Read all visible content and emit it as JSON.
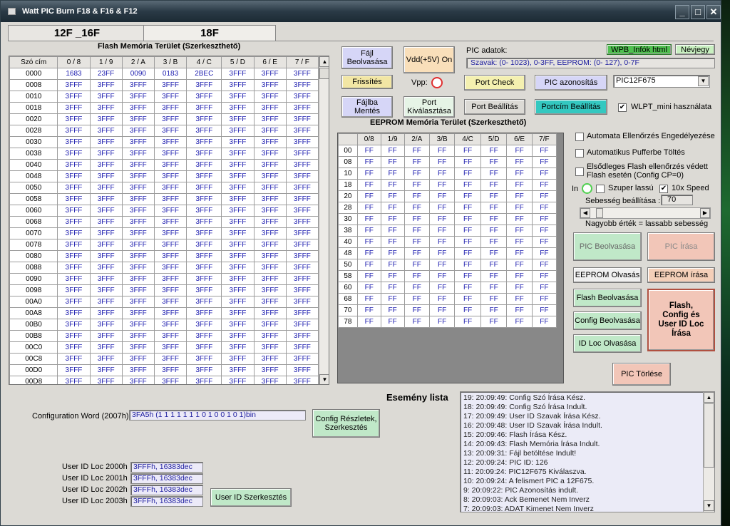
{
  "window": {
    "title": "Watt PIC Burn F18 & F16 & F12"
  },
  "tabs": [
    "12F _16F",
    "18F"
  ],
  "flash": {
    "title": "Flash Memória Terület (Szerkeszthető)",
    "headers": [
      "Szó cím",
      "0 / 8",
      "1 / 9",
      "2 / A",
      "3 / B",
      "4 / C",
      "5 / D",
      "6 / E",
      "7 / F"
    ],
    "rows": [
      [
        "0000",
        "1683",
        "23FF",
        "0090",
        "0183",
        "2BEC",
        "3FFF",
        "3FFF",
        "3FFF"
      ],
      [
        "0008",
        "3FFF",
        "3FFF",
        "3FFF",
        "3FFF",
        "3FFF",
        "3FFF",
        "3FFF",
        "3FFF"
      ],
      [
        "0010",
        "3FFF",
        "3FFF",
        "3FFF",
        "3FFF",
        "3FFF",
        "3FFF",
        "3FFF",
        "3FFF"
      ],
      [
        "0018",
        "3FFF",
        "3FFF",
        "3FFF",
        "3FFF",
        "3FFF",
        "3FFF",
        "3FFF",
        "3FFF"
      ],
      [
        "0020",
        "3FFF",
        "3FFF",
        "3FFF",
        "3FFF",
        "3FFF",
        "3FFF",
        "3FFF",
        "3FFF"
      ],
      [
        "0028",
        "3FFF",
        "3FFF",
        "3FFF",
        "3FFF",
        "3FFF",
        "3FFF",
        "3FFF",
        "3FFF"
      ],
      [
        "0030",
        "3FFF",
        "3FFF",
        "3FFF",
        "3FFF",
        "3FFF",
        "3FFF",
        "3FFF",
        "3FFF"
      ],
      [
        "0038",
        "3FFF",
        "3FFF",
        "3FFF",
        "3FFF",
        "3FFF",
        "3FFF",
        "3FFF",
        "3FFF"
      ],
      [
        "0040",
        "3FFF",
        "3FFF",
        "3FFF",
        "3FFF",
        "3FFF",
        "3FFF",
        "3FFF",
        "3FFF"
      ],
      [
        "0048",
        "3FFF",
        "3FFF",
        "3FFF",
        "3FFF",
        "3FFF",
        "3FFF",
        "3FFF",
        "3FFF"
      ],
      [
        "0050",
        "3FFF",
        "3FFF",
        "3FFF",
        "3FFF",
        "3FFF",
        "3FFF",
        "3FFF",
        "3FFF"
      ],
      [
        "0058",
        "3FFF",
        "3FFF",
        "3FFF",
        "3FFF",
        "3FFF",
        "3FFF",
        "3FFF",
        "3FFF"
      ],
      [
        "0060",
        "3FFF",
        "3FFF",
        "3FFF",
        "3FFF",
        "3FFF",
        "3FFF",
        "3FFF",
        "3FFF"
      ],
      [
        "0068",
        "3FFF",
        "3FFF",
        "3FFF",
        "3FFF",
        "3FFF",
        "3FFF",
        "3FFF",
        "3FFF"
      ],
      [
        "0070",
        "3FFF",
        "3FFF",
        "3FFF",
        "3FFF",
        "3FFF",
        "3FFF",
        "3FFF",
        "3FFF"
      ],
      [
        "0078",
        "3FFF",
        "3FFF",
        "3FFF",
        "3FFF",
        "3FFF",
        "3FFF",
        "3FFF",
        "3FFF"
      ],
      [
        "0080",
        "3FFF",
        "3FFF",
        "3FFF",
        "3FFF",
        "3FFF",
        "3FFF",
        "3FFF",
        "3FFF"
      ],
      [
        "0088",
        "3FFF",
        "3FFF",
        "3FFF",
        "3FFF",
        "3FFF",
        "3FFF",
        "3FFF",
        "3FFF"
      ],
      [
        "0090",
        "3FFF",
        "3FFF",
        "3FFF",
        "3FFF",
        "3FFF",
        "3FFF",
        "3FFF",
        "3FFF"
      ],
      [
        "0098",
        "3FFF",
        "3FFF",
        "3FFF",
        "3FFF",
        "3FFF",
        "3FFF",
        "3FFF",
        "3FFF"
      ],
      [
        "00A0",
        "3FFF",
        "3FFF",
        "3FFF",
        "3FFF",
        "3FFF",
        "3FFF",
        "3FFF",
        "3FFF"
      ],
      [
        "00A8",
        "3FFF",
        "3FFF",
        "3FFF",
        "3FFF",
        "3FFF",
        "3FFF",
        "3FFF",
        "3FFF"
      ],
      [
        "00B0",
        "3FFF",
        "3FFF",
        "3FFF",
        "3FFF",
        "3FFF",
        "3FFF",
        "3FFF",
        "3FFF"
      ],
      [
        "00B8",
        "3FFF",
        "3FFF",
        "3FFF",
        "3FFF",
        "3FFF",
        "3FFF",
        "3FFF",
        "3FFF"
      ],
      [
        "00C0",
        "3FFF",
        "3FFF",
        "3FFF",
        "3FFF",
        "3FFF",
        "3FFF",
        "3FFF",
        "3FFF"
      ],
      [
        "00C8",
        "3FFF",
        "3FFF",
        "3FFF",
        "3FFF",
        "3FFF",
        "3FFF",
        "3FFF",
        "3FFF"
      ],
      [
        "00D0",
        "3FFF",
        "3FFF",
        "3FFF",
        "3FFF",
        "3FFF",
        "3FFF",
        "3FFF",
        "3FFF"
      ],
      [
        "00D8",
        "3FFF",
        "3FFF",
        "3FFF",
        "3FFF",
        "3FFF",
        "3FFF",
        "3FFF",
        "3FFF"
      ]
    ]
  },
  "eeprom": {
    "title": "EEPROM Memória Terület (Szerkeszthető)",
    "headers": [
      "",
      "0/8",
      "1/9",
      "2/A",
      "3/B",
      "4/C",
      "5/D",
      "6/E",
      "7/F"
    ],
    "rows": [
      [
        "00",
        "FF",
        "FF",
        "FF",
        "FF",
        "FF",
        "FF",
        "FF",
        "FF"
      ],
      [
        "08",
        "FF",
        "FF",
        "FF",
        "FF",
        "FF",
        "FF",
        "FF",
        "FF"
      ],
      [
        "10",
        "FF",
        "FF",
        "FF",
        "FF",
        "FF",
        "FF",
        "FF",
        "FF"
      ],
      [
        "18",
        "FF",
        "FF",
        "FF",
        "FF",
        "FF",
        "FF",
        "FF",
        "FF"
      ],
      [
        "20",
        "FF",
        "FF",
        "FF",
        "FF",
        "FF",
        "FF",
        "FF",
        "FF"
      ],
      [
        "28",
        "FF",
        "FF",
        "FF",
        "FF",
        "FF",
        "FF",
        "FF",
        "FF"
      ],
      [
        "30",
        "FF",
        "FF",
        "FF",
        "FF",
        "FF",
        "FF",
        "FF",
        "FF"
      ],
      [
        "38",
        "FF",
        "FF",
        "FF",
        "FF",
        "FF",
        "FF",
        "FF",
        "FF"
      ],
      [
        "40",
        "FF",
        "FF",
        "FF",
        "FF",
        "FF",
        "FF",
        "FF",
        "FF"
      ],
      [
        "48",
        "FF",
        "FF",
        "FF",
        "FF",
        "FF",
        "FF",
        "FF",
        "FF"
      ],
      [
        "50",
        "FF",
        "FF",
        "FF",
        "FF",
        "FF",
        "FF",
        "FF",
        "FF"
      ],
      [
        "58",
        "FF",
        "FF",
        "FF",
        "FF",
        "FF",
        "FF",
        "FF",
        "FF"
      ],
      [
        "60",
        "FF",
        "FF",
        "FF",
        "FF",
        "FF",
        "FF",
        "FF",
        "FF"
      ],
      [
        "68",
        "FF",
        "FF",
        "FF",
        "FF",
        "FF",
        "FF",
        "FF",
        "FF"
      ],
      [
        "70",
        "FF",
        "FF",
        "FF",
        "FF",
        "FF",
        "FF",
        "FF",
        "FF"
      ],
      [
        "78",
        "FF",
        "FF",
        "FF",
        "FF",
        "FF",
        "FF",
        "FF",
        "FF"
      ]
    ]
  },
  "buttons": {
    "file_read": "Fájl\nBeolvasása",
    "vdd": "Vdd(+5V) On",
    "refresh": "Frissítés",
    "vpp": "Vpp:",
    "file_save": "Fájlba\nMentés",
    "port_select": "Port\nKiválasztása",
    "port_check": "Port Check",
    "port_settings": "Port Beállítás",
    "portaddr_settings": "Portcím Beállítás",
    "pic_id": "PIC azonosítás",
    "wpb_info": "WPB_Infók html",
    "about": "Névjegy",
    "pic_read": "PIC Beolvasása",
    "pic_write": "PIC  Írása",
    "eeprom_read": "EEPROM Olvasás",
    "eeprom_write": "EEPROM írása",
    "flash_read": "Flash Beolvasása",
    "flash_config_write": "Flash,\nConfig és\nUser ID Loc\nÍrása",
    "config_read": "Config Beolvasása",
    "idloc_read": "ID Loc Olvasása",
    "pic_erase": "PIC  Törlése",
    "config_details": "Config Részletek,\nSzerkesztés",
    "userid_edit": "User ID Szerkesztés"
  },
  "pic_info": {
    "label": "PIC adatok:",
    "value": "Szavak: (0- 1023),  0-3FF,   EEPROM: (0- 127),  0-7F",
    "model": "PIC12F675"
  },
  "options": {
    "wlpt": "WLPT_mini használata",
    "auto_verify": "Automata Ellenőrzés Engedélyezése",
    "auto_buffer": "Automatikus Pufferbe Töltés",
    "primary_flash": "Elsődleges Flash ellenőrzés védett\nFlash esetén (Config CP=0)",
    "in": "In",
    "super_slow": "Szuper lassú",
    "speed10x": "10x Speed",
    "speed_label": "Sebesség beállítása :",
    "speed_value": "70",
    "speed_hint": "Nagyobb érték = lassabb sebesség",
    "speed_level": 0.05
  },
  "config": {
    "label": "Configuration Word (2007h):",
    "value": "3FA5h  (1 1 1 1 1 1 1 0 1 0 0 1 0 1)bin"
  },
  "userid": [
    {
      "label": "User ID Loc 2000h",
      "value": "3FFFh, 16383dec"
    },
    {
      "label": "User ID Loc 2001h",
      "value": "3FFFh, 16383dec"
    },
    {
      "label": "User ID Loc 2002h",
      "value": "3FFFh, 16383dec"
    },
    {
      "label": "User ID Loc 2003h",
      "value": "3FFFh, 16383dec"
    }
  ],
  "events": {
    "title": "Esemény lista",
    "lines": [
      "19:  20:09:49:  Config Szó Írása Kész.",
      "18:  20:09:49:  Config Szó Írása Indult.",
      "17:  20:09:49:  User ID Szavak Írása Kész.",
      "16:  20:09:48:  User ID Szavak Írása Indult.",
      "15:  20:09:46:  Flash Írása Kész.",
      "14:  20:09:43:  Flash Memória Írása Indult.",
      "13:  20:09:31:  Fájl betöltése Indult!",
      "12:  20:09:24:  PIC ID: 126",
      "11:  20:09:24:  PIC12F675 Kiválaszva.",
      "10:  20:09:24:  A felismert PIC a 12F675.",
      "9:  20:09:22:  PIC Azonosítás indult.",
      "8:  20:09:03:  Ack Bemenet Nem Inverz",
      "7:  20:09:03:  ADAT Kimenet Nem Inverz"
    ]
  }
}
